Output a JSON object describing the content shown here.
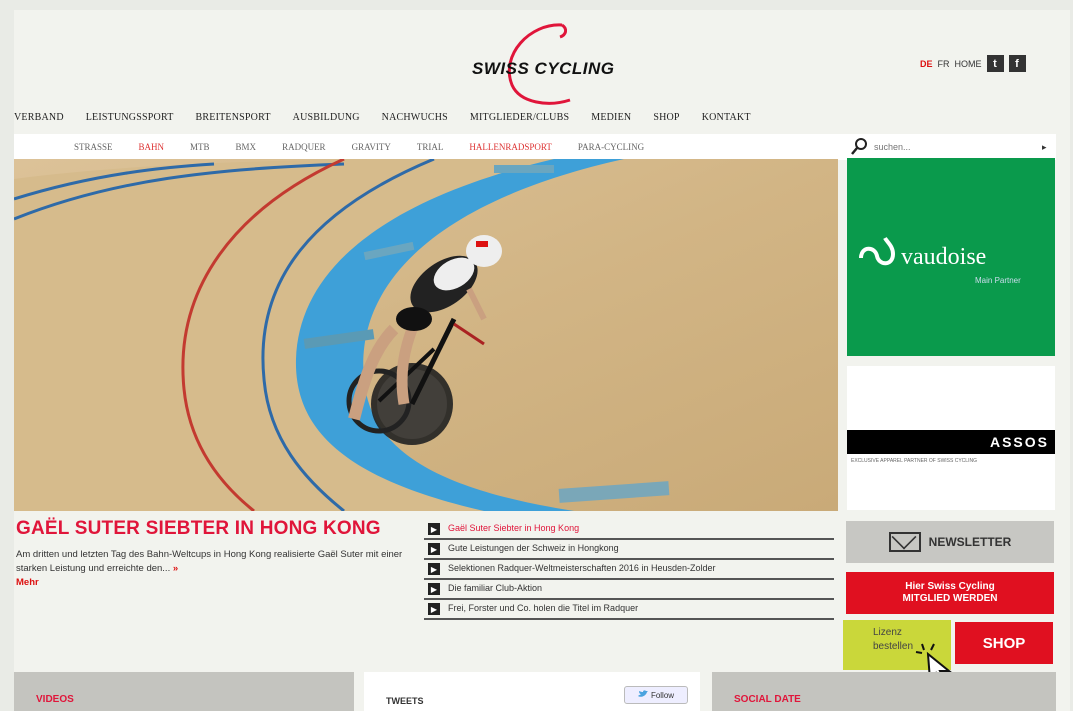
{
  "brand": {
    "logo_text": "SWISS CYCLING",
    "accent": "#e0153a",
    "green": "#0a9a4c"
  },
  "top": {
    "lang_de": "DE",
    "lang_fr": "FR",
    "home": "HOME",
    "twitter_glyph": "t",
    "facebook_glyph": "f"
  },
  "mainnav": [
    "VERBAND",
    "LEISTUNGSSPORT",
    "BREITENSPORT",
    "AUSBILDUNG",
    "NACHWUCHS",
    "MITGLIEDER/CLUBS",
    "MEDIEN",
    "SHOP",
    "KONTAKT"
  ],
  "subnav": [
    {
      "label": "STRASSE",
      "red": false
    },
    {
      "label": "BAHN",
      "red": true
    },
    {
      "label": "MTB",
      "red": false
    },
    {
      "label": "BMX",
      "red": false
    },
    {
      "label": "RADQUER",
      "red": false
    },
    {
      "label": "GRAVITY",
      "red": false
    },
    {
      "label": "TRIAL",
      "red": false
    },
    {
      "label": "HALLENRADSPORT",
      "red": true
    },
    {
      "label": "PARA-CYCLING",
      "red": false
    }
  ],
  "search": {
    "placeholder": "suchen...",
    "arrow": "▸"
  },
  "article": {
    "title": "GAËL SUTER SIEBTER IN HONG KONG",
    "teaser": "Am dritten und letzten Tag des Bahn-Weltcups in Hong Kong realisierte Gaël Suter mit einer starken Leistung und erreichte den...",
    "more_arrow": "»",
    "more": "Mehr"
  },
  "news": [
    {
      "text": "Gaël Suter Siebter in Hong Kong",
      "active": true
    },
    {
      "text": "Gute Leistungen der Schweiz in Hongkong",
      "active": false
    },
    {
      "text": "Selektionen Radquer-Weltmeisterschaften 2016 in Heusden-Zolder",
      "active": false
    },
    {
      "text": "Die familiar Club-Aktion",
      "active": false
    },
    {
      "text": "Frei, Forster und Co. holen die Titel im Radquer",
      "active": false
    }
  ],
  "news_bullet": "▶",
  "sidebar": {
    "vaudoise_name": "vaudoise",
    "vaudoise_sub": "Main Partner",
    "assos_name": "ASSOS",
    "assos_sub": "EXCLUSIVE APPAREL PARTNER OF SWISS CYCLING",
    "newsletter": "NEWSLETTER",
    "member_line1": "Hier Swiss Cycling",
    "member_line2": "MITGLIED WERDEN",
    "lizenz_line1": "Lizenz",
    "lizenz_line2": "bestellen",
    "shop": "SHOP"
  },
  "bottom": {
    "panel1_label": "VIDEOS",
    "panel2_label": "TWEETS",
    "follow": "Follow",
    "panel3_label": "SOCIAL DATE"
  }
}
